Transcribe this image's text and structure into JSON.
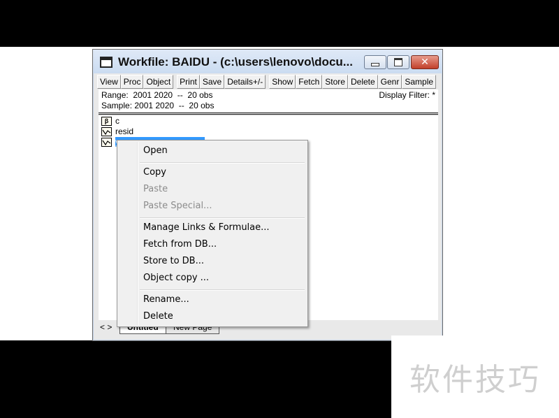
{
  "window": {
    "title": "Workfile: BAIDU - (c:\\users\\lenovo\\docu..."
  },
  "toolbar": {
    "buttons": [
      "View",
      "Proc",
      "Object",
      "Print",
      "Save",
      "Details+/-",
      "Show",
      "Fetch",
      "Store",
      "Delete",
      "Genr",
      "Sample"
    ]
  },
  "info": {
    "range": "Range:  2001 2020  --  20 obs",
    "sample": "Sample: 2001 2020  --  20 obs",
    "filter": "Display Filter: *"
  },
  "objects": [
    {
      "icon": "beta-icon",
      "glyph": "β",
      "name": "c"
    },
    {
      "icon": "series-icon",
      "glyph": "",
      "name": "resid"
    },
    {
      "icon": "series-icon",
      "glyph": "",
      "name": "y"
    }
  ],
  "tabs": {
    "arrows": "< >",
    "active": "Untitled",
    "other": "New Page"
  },
  "context_menu": {
    "items": [
      {
        "label": "Open",
        "enabled": true
      },
      {
        "label": "Copy",
        "enabled": true
      },
      {
        "label": "Paste",
        "enabled": false
      },
      {
        "label": "Paste Special...",
        "enabled": false
      },
      {
        "label": "Manage Links & Formulae...",
        "enabled": true
      },
      {
        "label": "Fetch from DB...",
        "enabled": true
      },
      {
        "label": "Store to DB...",
        "enabled": true
      },
      {
        "label": "Object copy ...",
        "enabled": true
      },
      {
        "label": "Rename...",
        "enabled": true
      },
      {
        "label": "Delete",
        "enabled": true
      }
    ]
  },
  "watermark": "软件技巧",
  "colors": {
    "selection": "#3399ff",
    "close_button": "#c2402a"
  }
}
